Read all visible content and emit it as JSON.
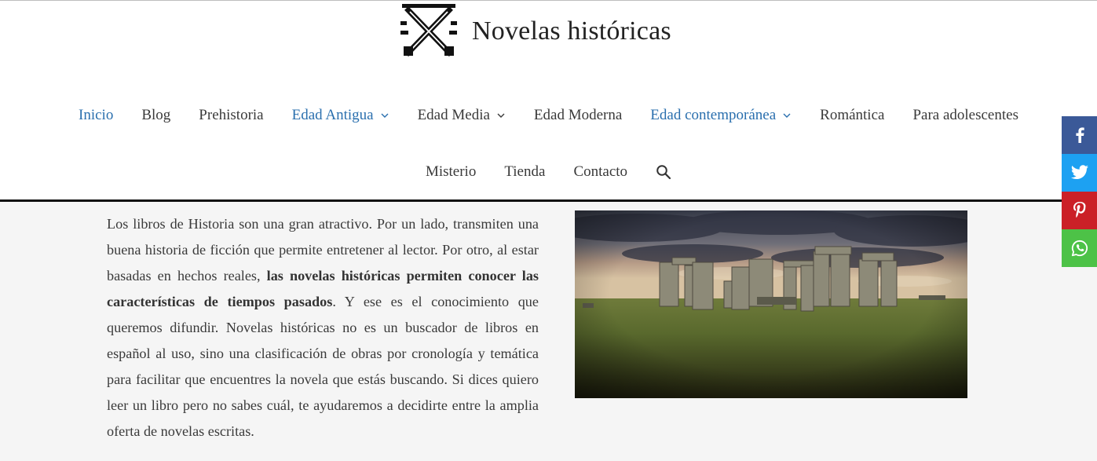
{
  "site": {
    "title": "Novelas históricas"
  },
  "nav": {
    "row1": [
      {
        "label": "Inicio",
        "active": true
      },
      {
        "label": "Blog"
      },
      {
        "label": "Prehistoria"
      },
      {
        "label": "Edad Antigua",
        "dropdown": true,
        "highlight": true
      },
      {
        "label": "Edad Media",
        "dropdown": true
      },
      {
        "label": "Edad Moderna"
      },
      {
        "label": "Edad contemporánea",
        "dropdown": true,
        "highlight": true
      },
      {
        "label": "Romántica"
      },
      {
        "label": "Para adolescentes"
      }
    ],
    "row2": [
      {
        "label": "Misterio"
      },
      {
        "label": "Tienda"
      },
      {
        "label": "Contacto"
      }
    ],
    "search_icon": "search-icon"
  },
  "intro": {
    "p1": "Los libros de Historia son una gran atractivo. Por un lado, transmiten una buena historia de ficción que permite entretener al lector. Por otro, al estar basadas en hechos reales, ",
    "bold": "las novelas históricas permiten conocer las características de tiempos pasados",
    "p2": ". Y ese es el conocimiento que queremos difundir. Novelas históricas no es un buscador de libros en español al uso, sino una clasificación de obras por cronología y temática para facilitar que encuentres la novela que estás buscando. Si dices quiero leer un libro pero no sabes cuál, te ayudaremos a decidirte entre la amplia oferta de novelas escritas."
  },
  "share": {
    "buttons": [
      {
        "icon": "facebook-icon",
        "color": "#3b5998"
      },
      {
        "icon": "twitter-icon",
        "color": "#1da1f2"
      },
      {
        "icon": "pinterest-icon",
        "color": "#cb2027"
      },
      {
        "icon": "whatsapp-icon",
        "color": "#4dc247"
      }
    ]
  },
  "colors": {
    "link": "#2a6fae",
    "text": "#3a3a3a",
    "content_bg": "#f5f5f5"
  }
}
